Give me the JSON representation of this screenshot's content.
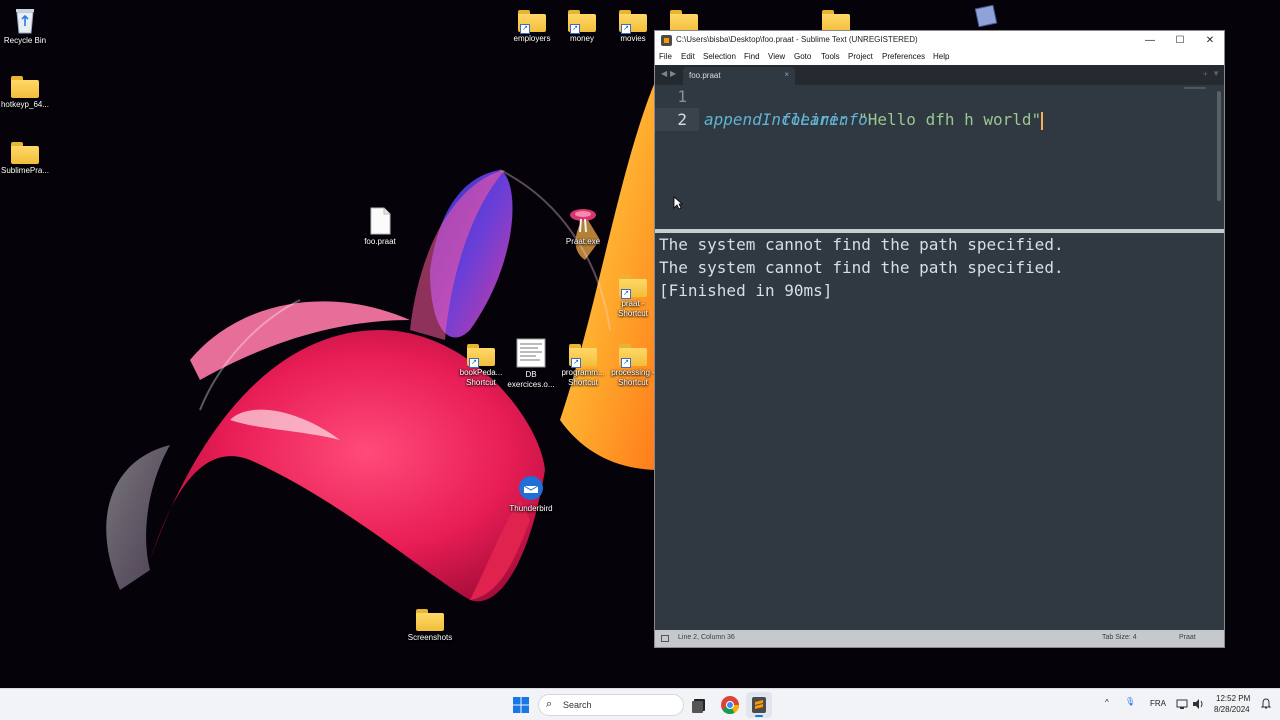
{
  "desktop": {
    "icons": {
      "recycle_bin": "Recycle Bin",
      "hotkeyp": "hotkeyp_64...",
      "sublimepra": "SublimePra...",
      "employers": "employers",
      "money": "money",
      "movies": "movies",
      "foo_praat": "foo.praat",
      "praat_exe": "Praat.exe",
      "praat_shortcut_1": "praat -",
      "praat_shortcut_2": "Shortcut",
      "bookpeda_1": "bookPeda...",
      "bookpeda_2": "Shortcut",
      "db_1": "DB",
      "db_2": "exercices.o...",
      "programm_1": "programm...",
      "programm_2": "Shortcut",
      "processing_1": "processing -",
      "processing_2": "Shortcut",
      "thunderbird": "Thunderbird",
      "screenshots": "Screenshots"
    }
  },
  "window": {
    "title": "C:\\Users\\bisba\\Desktop\\foo.praat - Sublime Text (UNREGISTERED)",
    "minimize": "—",
    "maximize": "☐",
    "close": "✕",
    "menu": [
      "File",
      "Edit",
      "Selection",
      "Find",
      "View",
      "Goto",
      "Tools",
      "Project",
      "Preferences",
      "Help"
    ],
    "tab": {
      "label": "foo.praat",
      "close": "×"
    },
    "nav": {
      "back": "◀",
      "forward": "▶"
    },
    "tab_new": "+",
    "tab_dropdown": "▼",
    "editor": {
      "line_numbers": [
        "1",
        "2"
      ],
      "line1": {
        "code": "clearinfo"
      },
      "line2": {
        "keyword": "appendInfoLine:",
        "space": " ",
        "string": "\"Hello dfh h world\""
      }
    },
    "output": [
      "The system cannot find the path specified.",
      "The system cannot find the path specified.",
      "[Finished in 90ms]"
    ],
    "status": {
      "position": "Line 2, Column 36",
      "tab_size": "Tab Size: 4",
      "syntax": "Praat"
    }
  },
  "taskbar": {
    "search_icon": "⌕",
    "search_label": "Search",
    "tray": {
      "chevron": "^",
      "mic": "🎙",
      "language": "FRA",
      "time": "12:52 PM",
      "date": "8/28/2024"
    }
  },
  "colors": {
    "editor_bg": "#303841",
    "keyword": "#5fb3d3",
    "string": "#99c794",
    "output_text": "#d8dee9",
    "cursor": "#f9ae58"
  }
}
